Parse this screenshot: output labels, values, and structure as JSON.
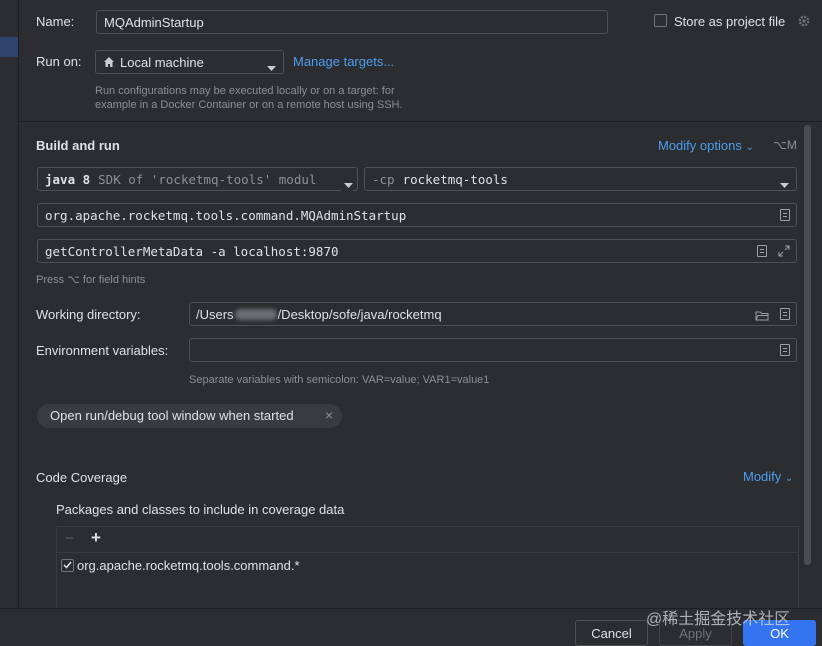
{
  "form": {
    "name_label": "Name:",
    "name_value": "MQAdminStartup",
    "store_label": "Store as project file",
    "run_on_label": "Run on:",
    "run_on_value": "Local machine",
    "manage_targets": "Manage targets...",
    "run_on_hint_1": "Run configurations may be executed locally or on a target: for",
    "run_on_hint_2": "example in a Docker Container or on a remote host using SSH."
  },
  "build": {
    "section_title": "Build and run",
    "modify_options": "Modify options",
    "modify_shortcut": "⌥M",
    "jdk_bold": "java 8",
    "jdk_rest": "SDK of 'rocketmq-tools' modul",
    "cp_prefix": "-cp",
    "cp_module": "rocketmq-tools",
    "main_class": "org.apache.rocketmq.tools.command.MQAdminStartup",
    "program_args": "getControllerMetaData -a localhost:9870",
    "field_hints": "Press ⌥ for field hints",
    "working_dir_label": "Working directory:",
    "working_dir_value_a": "/Users",
    "working_dir_value_b": "/Desktop/sofe/java/rocketmq",
    "env_label": "Environment variables:",
    "env_value": "",
    "env_hint": "Separate variables with semicolon: VAR=value; VAR1=value1",
    "chip_label": "Open run/debug tool window when started",
    "chip_close": "×"
  },
  "coverage": {
    "title": "Code Coverage",
    "modify": "Modify",
    "packages_title": "Packages and classes to include in coverage data",
    "remove_symbol": "−",
    "add_symbol": "+",
    "items": [
      {
        "label": "org.apache.rocketmq.tools.command.*",
        "checked": true
      }
    ]
  },
  "footer": {
    "cancel": "Cancel",
    "apply": "Apply",
    "ok": "OK",
    "watermark": "@稀土掘金技术社区"
  },
  "colors": {
    "accent": "#4c9ef0",
    "ok_button": "#3574f0",
    "background": "#2b2d30",
    "border": "#4e5157"
  },
  "icons": {
    "home": "home-icon",
    "dropdown": "chevron-down-icon",
    "gear": "gear-icon",
    "folder": "folder-icon",
    "document": "document-icon",
    "expand": "expand-icon"
  }
}
